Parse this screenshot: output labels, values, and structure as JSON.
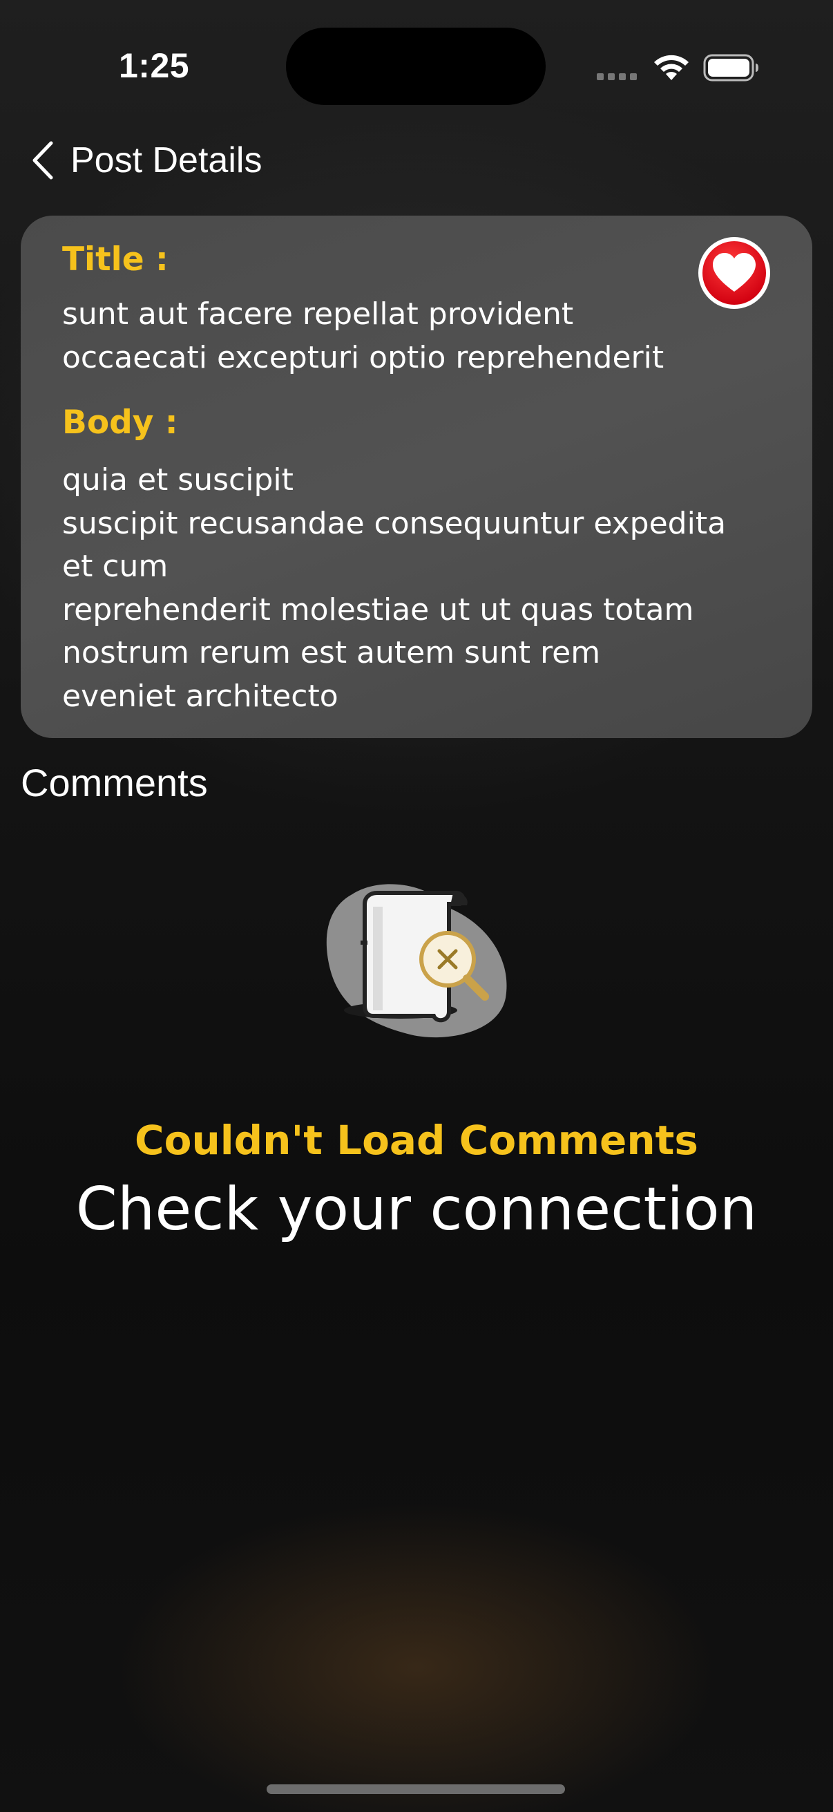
{
  "status_bar": {
    "time": "1:25",
    "icons": [
      "cellular-signal-icon",
      "wifi-icon",
      "battery-icon"
    ]
  },
  "nav": {
    "back_icon": "chevron-left-icon",
    "title": "Post Details"
  },
  "post": {
    "title_label": "Title :",
    "title_text": "sunt aut facere repellat provident\noccaecati excepturi optio reprehenderit",
    "body_label": "Body :",
    "body_text": "quia et suscipit\nsuscipit recusandae consequuntur expedita\net cum\nreprehenderit molestiae ut ut quas totam\nnostrum rerum est autem sunt rem\neveniet architecto",
    "favorite_icon": "heart-icon",
    "favorited": true
  },
  "comments": {
    "heading": "Comments",
    "empty_icon": "document-search-error-icon",
    "error_title": "Couldn't Load Comments",
    "error_subtitle": "Check your connection"
  },
  "colors": {
    "accent": "#f6c21c",
    "card": "#4e4e4e",
    "favorite": "#e8111c",
    "text": "#ffffff"
  }
}
